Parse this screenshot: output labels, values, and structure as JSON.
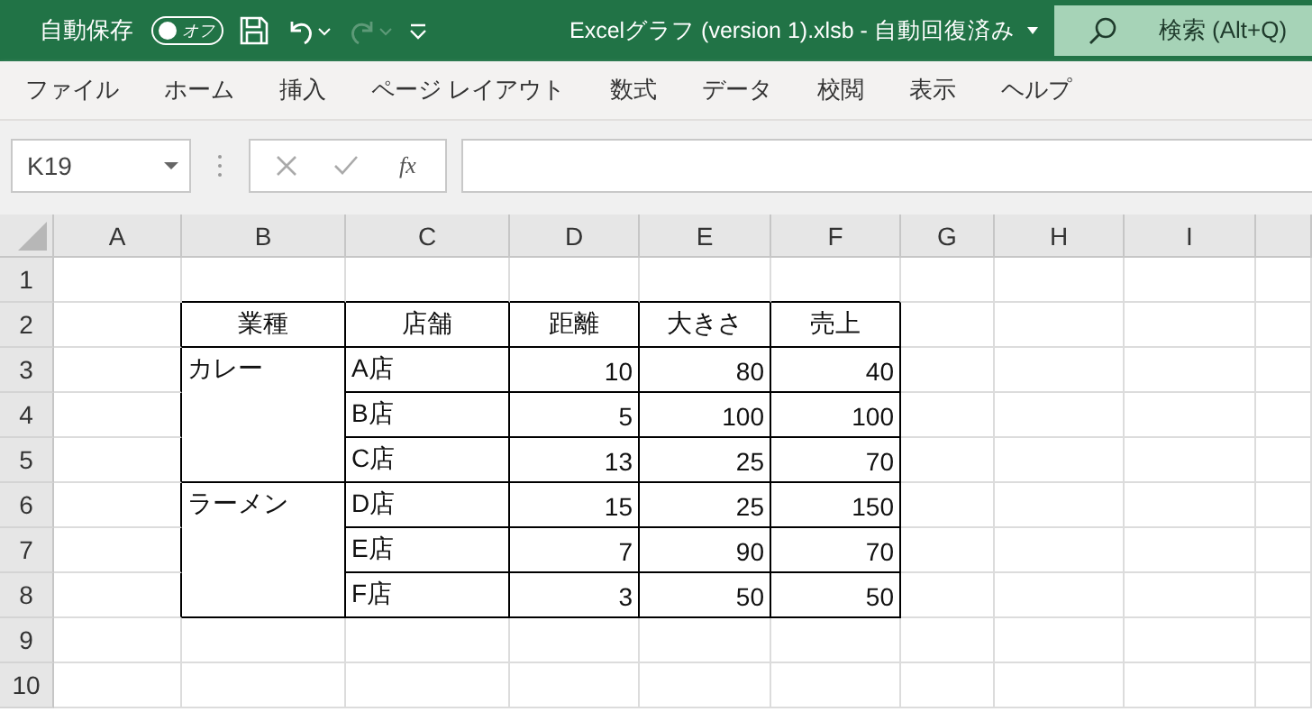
{
  "title_bar": {
    "autosave": {
      "label": "自動保存",
      "on": false,
      "state_text": "オフ"
    },
    "document_title": "Excelグラフ (version 1).xlsb  -  自動回復済み",
    "search": {
      "label": "検索 (Alt+Q)"
    }
  },
  "menu": [
    "ファイル",
    "ホーム",
    "挿入",
    "ページ レイアウト",
    "数式",
    "データ",
    "校閲",
    "表示",
    "ヘルプ"
  ],
  "formula_bar": {
    "name_box": "K19",
    "function_label": "fx"
  },
  "sheet": {
    "columns": [
      "A",
      "B",
      "C",
      "D",
      "E",
      "F",
      "G",
      "H",
      "I"
    ],
    "row_numbers": [
      "1",
      "2",
      "3",
      "4",
      "5",
      "6",
      "7",
      "8",
      "9",
      "10"
    ],
    "data_table": {
      "columns": [
        "業種",
        "店舗",
        "距離",
        "大きさ",
        "売上"
      ],
      "rows": [
        {
          "category": "カレー",
          "store": "A店",
          "distance": "10",
          "size": "80",
          "sales": "40"
        },
        {
          "store": "B店",
          "distance": "5",
          "size": "100",
          "sales": "100"
        },
        {
          "store": "C店",
          "distance": "13",
          "size": "25",
          "sales": "70"
        },
        {
          "category": "ラーメン",
          "store": "D店",
          "distance": "15",
          "size": "25",
          "sales": "150"
        },
        {
          "store": "E店",
          "distance": "7",
          "size": "90",
          "sales": "70"
        },
        {
          "store": "F店",
          "distance": "3",
          "size": "50",
          "sales": "50"
        }
      ]
    }
  }
}
